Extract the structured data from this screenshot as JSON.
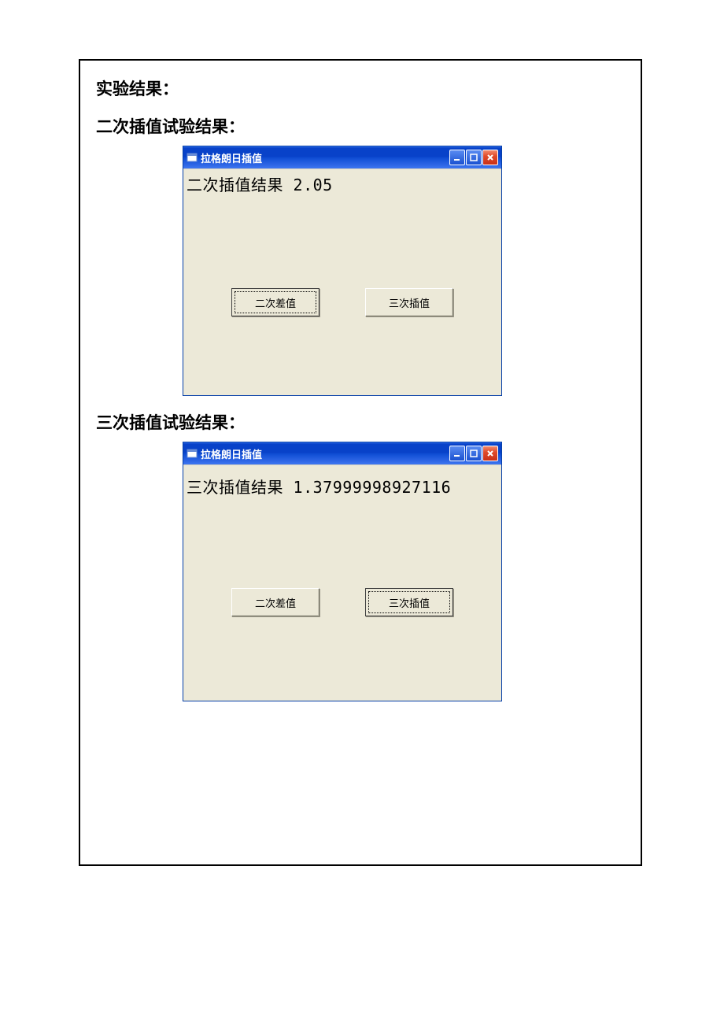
{
  "doc": {
    "heading": "实验结果：",
    "section1_title": "二次插值试验结果：",
    "section2_title": "三次插值试验结果："
  },
  "window1": {
    "title": "拉格朗日插值",
    "result_text": "二次插值结果 2.05",
    "button1": "二次差值",
    "button2": "三次插值"
  },
  "window2": {
    "title": "拉格朗日插值",
    "result_text": "三次插值结果 1.37999998927116",
    "button1": "二次差值",
    "button2": "三次插值"
  },
  "icons": {
    "form_icon": "▭",
    "min": "_",
    "max": "□",
    "close": "✕"
  }
}
